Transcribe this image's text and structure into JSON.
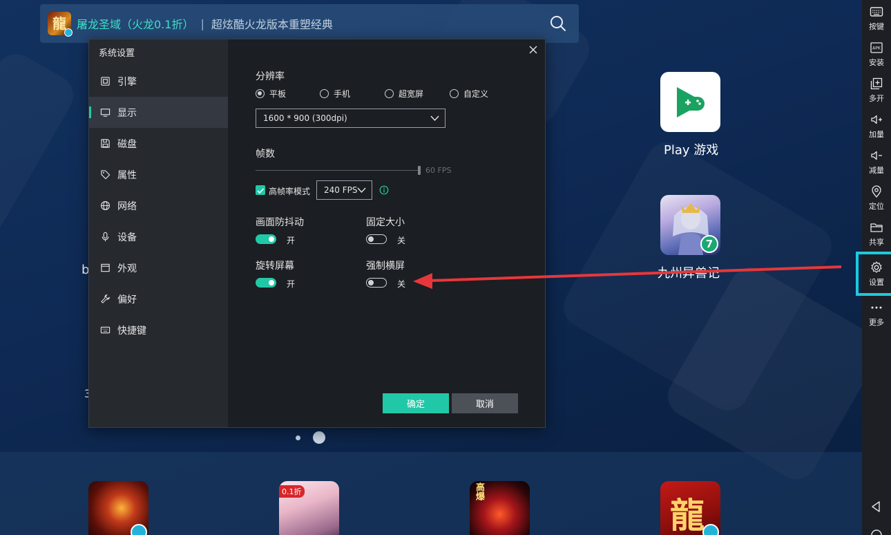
{
  "search": {
    "game_icon_text": "龍",
    "title": "屠龙圣域（火龙0.1折）",
    "separator": "|",
    "subtitle": "超炫酷火龙版本重塑经典"
  },
  "desktop_apps": [
    {
      "label": "Play 游戏"
    },
    {
      "label": "九州异兽记",
      "badge": "7"
    }
  ],
  "desktop_partial_text": {
    "left_b": "b",
    "left_3": "3"
  },
  "dock_icons": [
    {
      "name": "legend-game",
      "text": ""
    },
    {
      "name": "fairy-game",
      "text": "0.1折"
    },
    {
      "name": "warrior-game",
      "text": "高爆"
    },
    {
      "name": "dragon-game",
      "text": "龍"
    }
  ],
  "toolbar": {
    "items": [
      {
        "label": "按键"
      },
      {
        "label": "安装"
      },
      {
        "label": "多开"
      },
      {
        "label": "加量"
      },
      {
        "label": "减量"
      },
      {
        "label": "定位"
      },
      {
        "label": "共享"
      },
      {
        "label": "设置"
      },
      {
        "label": "更多"
      }
    ],
    "apk_text": "APK"
  },
  "dialog": {
    "title": "系统设置",
    "nav": [
      {
        "label": "引擎"
      },
      {
        "label": "显示"
      },
      {
        "label": "磁盘"
      },
      {
        "label": "属性"
      },
      {
        "label": "网络"
      },
      {
        "label": "设备"
      },
      {
        "label": "外观"
      },
      {
        "label": "偏好"
      },
      {
        "label": "快捷键"
      }
    ],
    "active_nav": "显示",
    "resolution": {
      "label": "分辨率",
      "options": [
        "平板",
        "手机",
        "超宽屏",
        "自定义"
      ],
      "selected": "平板",
      "value": "1600 * 900 (300dpi)"
    },
    "fps": {
      "label": "帧数",
      "slider_value": "60 FPS",
      "slider_level_percent": 100,
      "high_fps_label": "高帧率模式",
      "high_fps_checked": true,
      "high_fps_value": "240 FPS"
    },
    "toggles": {
      "anti_shake": {
        "label": "画面防抖动",
        "state": "开",
        "on": true
      },
      "fixed_size": {
        "label": "固定大小",
        "state": "关",
        "on": false
      },
      "rotate_screen": {
        "label": "旋转屏幕",
        "state": "开",
        "on": true
      },
      "force_landscape": {
        "label": "强制横屏",
        "state": "关",
        "on": false
      }
    },
    "buttons": {
      "ok": "确定",
      "cancel": "取消"
    }
  },
  "colors": {
    "accent": "#21c8a7",
    "highlight_box": "#1ecadb",
    "annotation_arrow": "#e8373a"
  }
}
